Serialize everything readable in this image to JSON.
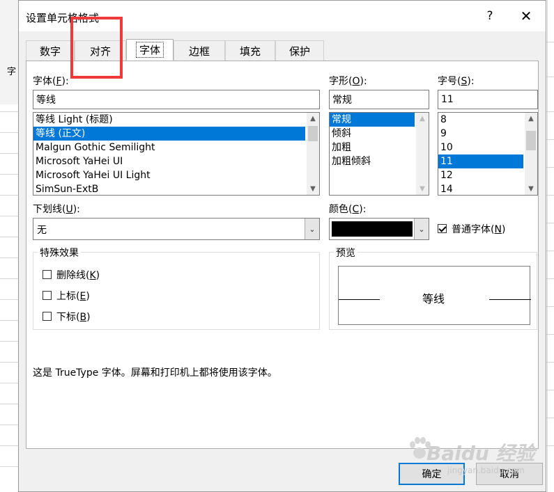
{
  "dialog": {
    "title": "设置单元格格式",
    "help": "?",
    "close": "✕"
  },
  "tabs": [
    {
      "label": "数字"
    },
    {
      "label": "对齐"
    },
    {
      "label": "字体"
    },
    {
      "label": "边框"
    },
    {
      "label": "填充"
    },
    {
      "label": "保护"
    }
  ],
  "font": {
    "label": "字体(",
    "key": "F",
    "label_end": "):",
    "value": "等线",
    "items": [
      "等线 Light (标题)",
      "等线 (正文)",
      "Malgun Gothic Semilight",
      "Microsoft YaHei UI",
      "Microsoft YaHei UI Light",
      "SimSun-ExtB"
    ],
    "selected_index": 1
  },
  "style": {
    "label": "字形(",
    "key": "O",
    "label_end": "):",
    "value": "常规",
    "items": [
      "常规",
      "倾斜",
      "加粗",
      "加粗倾斜"
    ],
    "selected_index": 0
  },
  "size": {
    "label": "字号(",
    "key": "S",
    "label_end": "):",
    "value": "11",
    "items": [
      "8",
      "9",
      "10",
      "11",
      "12",
      "14"
    ],
    "selected_index": 3
  },
  "underline": {
    "label": "下划线(",
    "key": "U",
    "label_end": "):",
    "value": "无"
  },
  "color": {
    "label": "颜色(",
    "key": "C",
    "label_end": "):",
    "value": "#000000"
  },
  "normal_font": {
    "label": "普通字体(",
    "key": "N",
    "label_end": ")",
    "checked": true
  },
  "effects": {
    "title": "特殊效果",
    "items": [
      {
        "label": "删除线(",
        "key": "K",
        "label_end": ")",
        "checked": false
      },
      {
        "label": "上标(",
        "key": "E",
        "label_end": ")",
        "checked": false
      },
      {
        "label": "下标(",
        "key": "B",
        "label_end": ")",
        "checked": false
      }
    ]
  },
  "preview": {
    "title": "预览",
    "sample": "等线"
  },
  "description": "这是 TrueType 字体。屏幕和打印机上都将使用该字体。",
  "buttons": {
    "ok": "确定",
    "cancel": "取消"
  },
  "background": {
    "row_label": "字"
  },
  "watermark": {
    "brand": "Baidu 经验",
    "url": "jingyan.baidu.com"
  }
}
